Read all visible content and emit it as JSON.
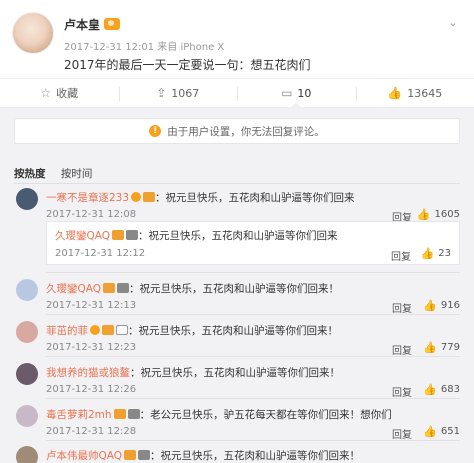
{
  "post": {
    "author": "卢本皇",
    "meta": "2017-12-31 12:01 来自 iPhone X",
    "text": "2017年的最后一天一定要说一句：想五花肉们"
  },
  "actions": [
    {
      "icon": "star-icon",
      "label": "收藏"
    },
    {
      "icon": "share-icon",
      "label": "1067"
    },
    {
      "icon": "comment-icon",
      "label": "10"
    },
    {
      "icon": "thumbs-up-icon",
      "label": "13645"
    }
  ],
  "notice": "由于用户设置，你无法回复评论。",
  "sort": {
    "hot": "按热度",
    "time": "按时间"
  },
  "reply_label": "回复",
  "comments": [
    {
      "user": "一寒不是章逐233",
      "text": "：祝元旦快乐，五花肉和山驴逼等你们回来",
      "time": "2017-12-31 12:08",
      "likes": "1605",
      "avatar_color": "#4a5a70"
    },
    {
      "user": "久瓔鑾QAQ",
      "text": "：祝元旦快乐，五花肉和山驴逼等你们回来",
      "time": "2017-12-31 12:12",
      "likes": "23",
      "avatar_color": ""
    },
    {
      "user": "久瓔鑾QAQ",
      "text": "：祝元旦快乐，五花肉和山驴逼等你们回来！",
      "time": "2017-12-31 12:13",
      "likes": "916",
      "avatar_color": "#b9c8e2"
    },
    {
      "user": "菲茁的菲",
      "text": "：祝元旦快乐，五花肉和山驴逼等你们回来！",
      "time": "2017-12-31 12:23",
      "likes": "779",
      "avatar_color": "#d8a9a0"
    },
    {
      "user": "我想养的猫或狼鳌",
      "text": "：祝元旦快乐，五花肉和山驴逼等你们回来！",
      "time": "2017-12-31 12:26",
      "likes": "683",
      "avatar_color": "#6a5a6a"
    },
    {
      "user": "毒舌萝莉2mh",
      "text": "：老公元旦快乐，驴五花每天都在等你们回来！想你们",
      "time": "2017-12-31 12:28",
      "likes": "651",
      "avatar_color": "#c9b9c8"
    },
    {
      "user": "卢本伟最帅QAQ",
      "text": "：祝元旦快乐，五花肉和山驴逼等你们回来！",
      "time": "",
      "likes": "",
      "avatar_color": "#a08a78"
    }
  ]
}
